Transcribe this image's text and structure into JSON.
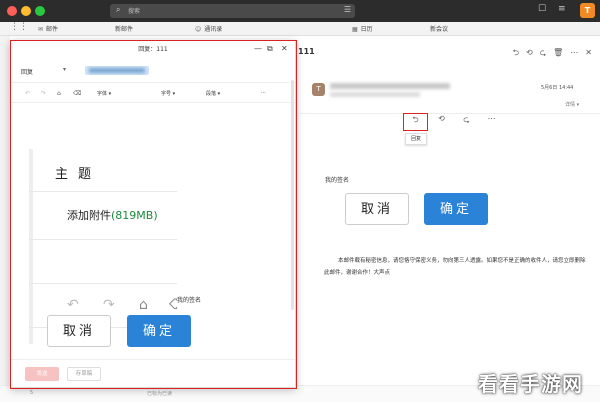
{
  "titlebar": {
    "search_placeholder": "搜索",
    "avatar_letter": "T",
    "window_dots": [
      "#ff5f57",
      "#febc2e",
      "#28c840"
    ]
  },
  "tabs": [
    {
      "label": "邮件",
      "icon": "mail-icon"
    },
    {
      "label": "新邮件",
      "icon": "compose-icon"
    },
    {
      "label": "通讯录",
      "icon": "contacts-icon"
    },
    {
      "label": "日历",
      "icon": "calendar-icon"
    },
    {
      "label": "新会议",
      "icon": "meeting-icon"
    }
  ],
  "message": {
    "subject": "111",
    "sender_initial": "T",
    "date": "5月6日 14:44",
    "detail_label": "详情",
    "reply_tooltip": "回复",
    "signature": "我的签名",
    "cancel_label": "取消",
    "ok_label": "确定",
    "notice": "本邮件载有秘密信息，请您恪守保密义务，勿向第三人透露。如果您不是正确的收件人，请您立即删除此邮件，谢谢合作！大声点"
  },
  "compose": {
    "title": "回复：111",
    "reply_mode": "回复",
    "toolbar": {
      "font": "字体",
      "size": "字号",
      "paragraph": "段落",
      "more": "···"
    },
    "zoom": {
      "subject_label": "主题",
      "attach_prefix": "添加附件",
      "attach_size": "(819MB)"
    },
    "signature": "我的签名",
    "cancel_label": "取消",
    "ok_label": "确定",
    "send_label": "发送",
    "draft_label": "存草稿"
  },
  "bottom": {
    "count": "5",
    "note": "已标为已读"
  },
  "colors": {
    "accent": "#2b83d8",
    "highlight": "#dd2222",
    "avatar": "#f08a24"
  },
  "watermark": "看看手游网"
}
